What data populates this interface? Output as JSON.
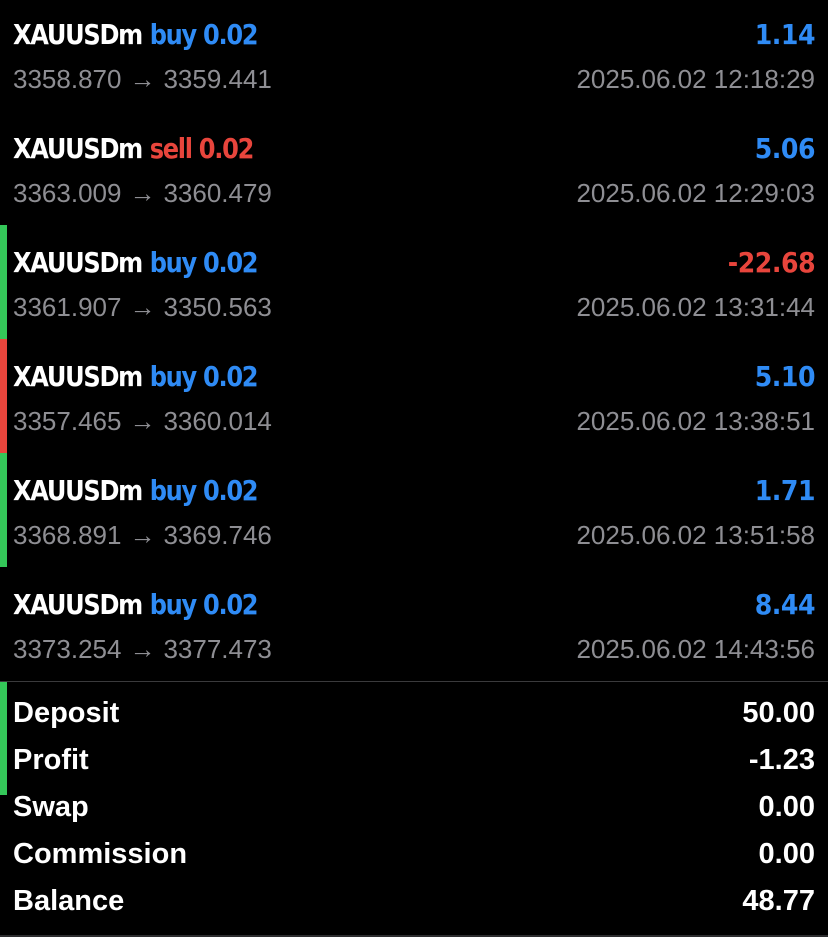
{
  "trades": [
    {
      "symbol": "XAUUSDm",
      "side": "buy 0.02",
      "side_color": "#2f8bf5",
      "profit": "1.14",
      "profit_color": "#2f8bf5",
      "open_price": "3358.870",
      "close_price": "3359.441",
      "time": "2025.06.02 12:18:29",
      "indicator_color": ""
    },
    {
      "symbol": "XAUUSDm",
      "side": "sell 0.02",
      "side_color": "#e8453c",
      "profit": "5.06",
      "profit_color": "#2f8bf5",
      "open_price": "3363.009",
      "close_price": "3360.479",
      "time": "2025.06.02 12:29:03",
      "indicator_color": "#34c759"
    },
    {
      "symbol": "XAUUSDm",
      "side": "buy 0.02",
      "side_color": "#2f8bf5",
      "profit": "-22.68",
      "profit_color": "#e8453c",
      "open_price": "3361.907",
      "close_price": "3350.563",
      "time": "2025.06.02 13:31:44",
      "indicator_color": "#e8453c"
    },
    {
      "symbol": "XAUUSDm",
      "side": "buy 0.02",
      "side_color": "#2f8bf5",
      "profit": "5.10",
      "profit_color": "#2f8bf5",
      "open_price": "3357.465",
      "close_price": "3360.014",
      "time": "2025.06.02 13:38:51",
      "indicator_color": "#34c759"
    },
    {
      "symbol": "XAUUSDm",
      "side": "buy 0.02",
      "side_color": "#2f8bf5",
      "profit": "1.71",
      "profit_color": "#2f8bf5",
      "open_price": "3368.891",
      "close_price": "3369.746",
      "time": "2025.06.02 13:51:58",
      "indicator_color": ""
    },
    {
      "symbol": "XAUUSDm",
      "side": "buy 0.02",
      "side_color": "#2f8bf5",
      "profit": "8.44",
      "profit_color": "#2f8bf5",
      "open_price": "3373.254",
      "close_price": "3377.473",
      "time": "2025.06.02 14:43:56",
      "indicator_color": "#34c759"
    }
  ],
  "arrow_glyph": "→",
  "summary": {
    "deposit_label": "Deposit",
    "deposit_value": "50.00",
    "profit_label": "Profit",
    "profit_value": "-1.23",
    "swap_label": "Swap",
    "swap_value": "0.00",
    "commission_label": "Commission",
    "commission_value": "0.00",
    "balance_label": "Balance",
    "balance_value": "48.77"
  }
}
